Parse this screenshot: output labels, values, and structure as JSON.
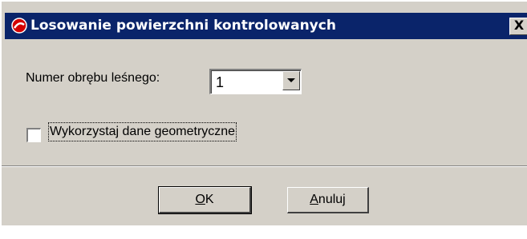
{
  "window": {
    "title": "Losowanie powierzchni kontrolowanych",
    "close_label": "X"
  },
  "form": {
    "forest_label": "Numer obrębu leśnego:",
    "forest_value": "1",
    "geometry_checkbox_label": "Wykorzystaj dane geometryczne",
    "geometry_checked": false
  },
  "buttons": {
    "ok_mnemonic": "O",
    "ok_rest": "K",
    "cancel_mnemonic": "A",
    "cancel_rest": "nuluj"
  },
  "colors": {
    "titlebar": "#0a246a",
    "dialog_bg": "#d4d0c8",
    "app_icon": "#d40000"
  },
  "icons": {
    "app": "app-logo-icon",
    "close": "close-icon",
    "dropdown": "chevron-down-icon"
  }
}
